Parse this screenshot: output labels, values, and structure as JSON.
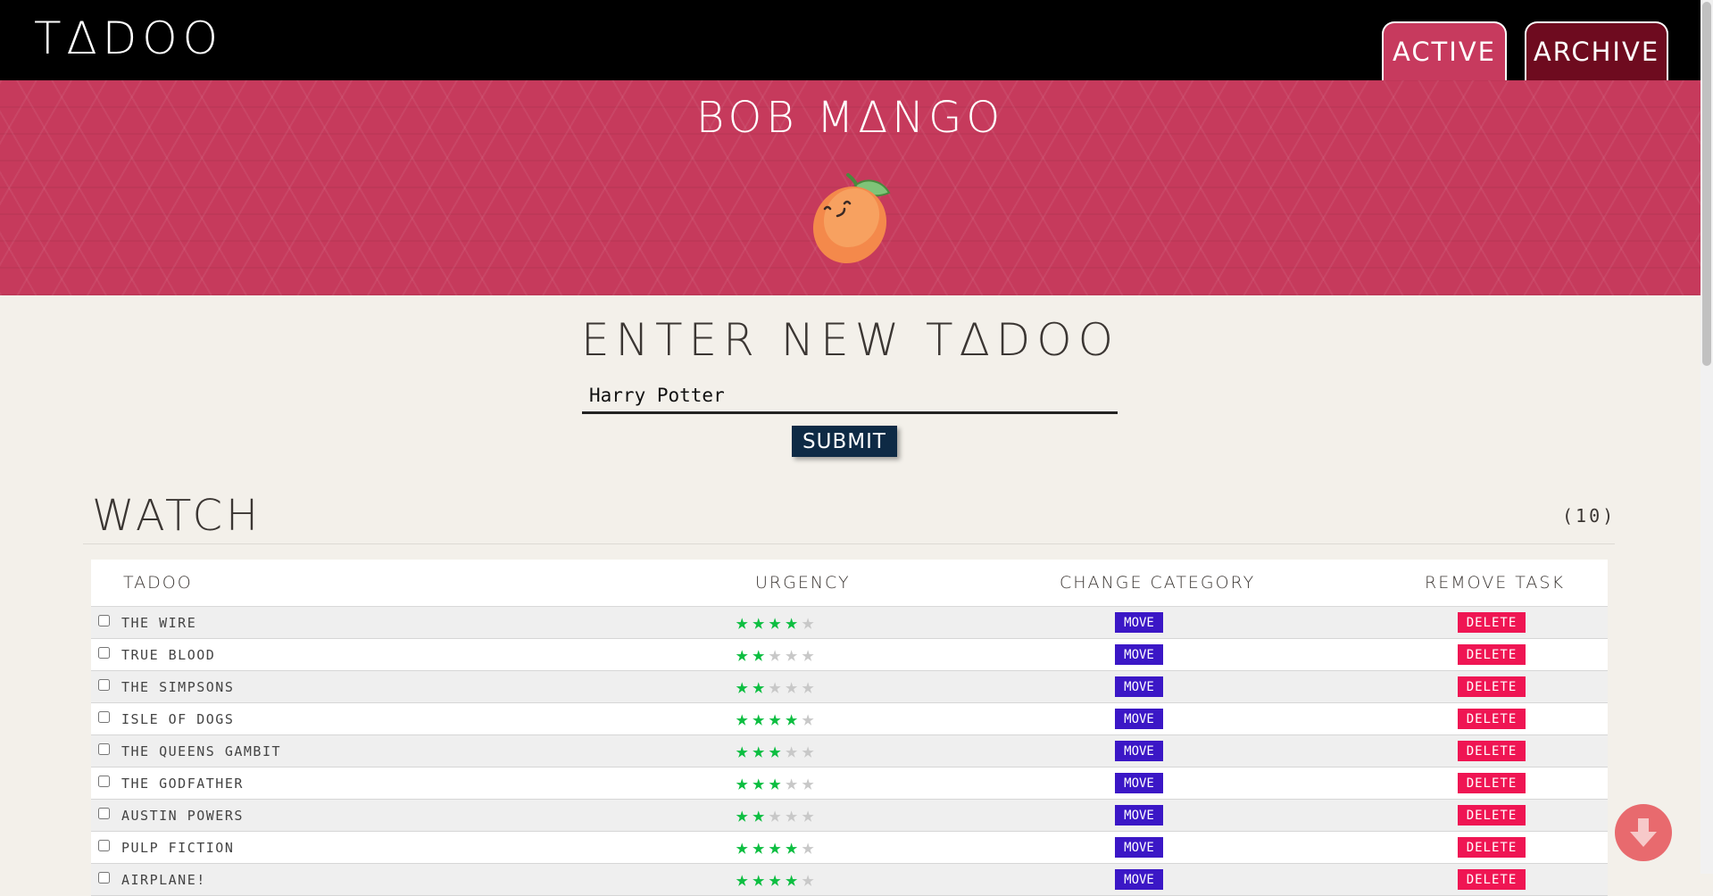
{
  "app": {
    "logo": "TΔDOO"
  },
  "nav": {
    "tabs": [
      {
        "label": "ACTIVE"
      },
      {
        "label": "ARCHIVE"
      }
    ]
  },
  "banner": {
    "user_name": "BOB MΔNGO",
    "avatar": "mango-icon"
  },
  "new_task": {
    "title": "ENTER NEW TΔDOO",
    "value": "Harry Potter",
    "submit_label": "SUBMIT"
  },
  "category": {
    "name": "WATCH",
    "count": "(10)",
    "headers": {
      "task": "TADOO",
      "urgency": "URGENCY",
      "change": "CHANGE CATEGORY",
      "remove": "REMOVE TASK"
    },
    "move_label": "MOVE",
    "delete_label": "DELETE",
    "tasks": [
      {
        "name": "THE WIRE",
        "urgency": 4
      },
      {
        "name": "TRUE BLOOD",
        "urgency": 2
      },
      {
        "name": "THE SIMPSONS",
        "urgency": 2
      },
      {
        "name": "ISLE OF DOGS",
        "urgency": 4
      },
      {
        "name": "THE QUEENS GAMBIT",
        "urgency": 3
      },
      {
        "name": "THE GODFATHER",
        "urgency": 3
      },
      {
        "name": "AUSTIN POWERS",
        "urgency": 2
      },
      {
        "name": "PULP FICTION",
        "urgency": 4
      },
      {
        "name": "AIRPLANE!",
        "urgency": 4
      }
    ],
    "max_urgency": 5
  },
  "scroll_button": {
    "icon": "arrow-down-icon"
  },
  "colors": {
    "banner": "#c63a5c",
    "star_on": "#0dbe41",
    "move": "#3b17c6",
    "delete": "#ef1553",
    "submit": "#0e2a45"
  }
}
